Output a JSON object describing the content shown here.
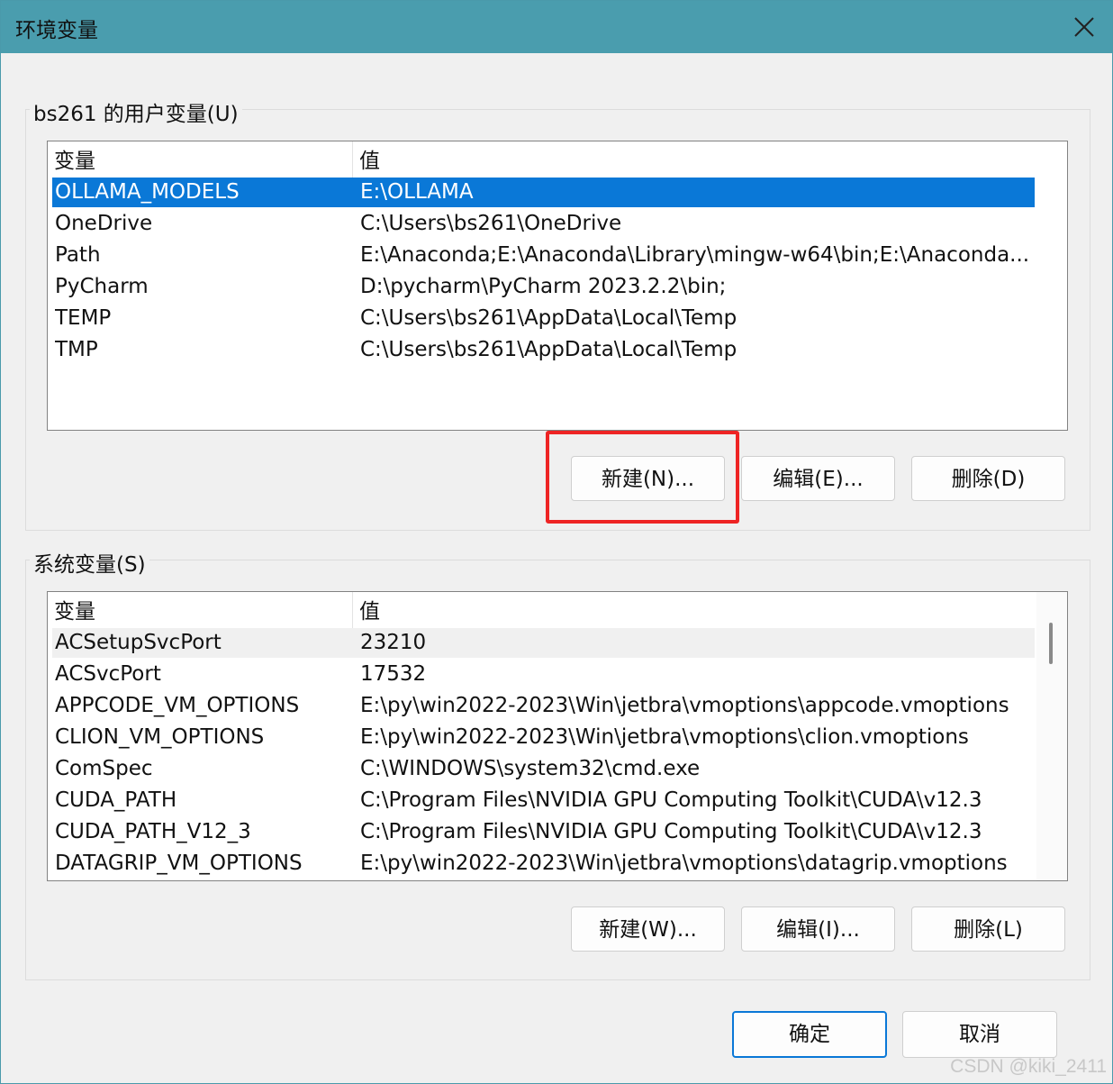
{
  "window": {
    "title": "环境变量",
    "close_icon": "close-icon"
  },
  "user_vars": {
    "group_label": "bs261 的用户变量(U)",
    "columns": [
      "变量",
      "值"
    ],
    "rows": [
      {
        "name": "OLLAMA_MODELS",
        "value": "E:\\OLLAMA"
      },
      {
        "name": "OneDrive",
        "value": "C:\\Users\\bs261\\OneDrive"
      },
      {
        "name": "Path",
        "value": "E:\\Anaconda;E:\\Anaconda\\Library\\mingw-w64\\bin;E:\\Anaconda..."
      },
      {
        "name": "PyCharm",
        "value": "D:\\pycharm\\PyCharm 2023.2.2\\bin;"
      },
      {
        "name": "TEMP",
        "value": "C:\\Users\\bs261\\AppData\\Local\\Temp"
      },
      {
        "name": "TMP",
        "value": "C:\\Users\\bs261\\AppData\\Local\\Temp"
      }
    ],
    "selected_row": 0,
    "buttons": {
      "new_label": "新建(N)...",
      "edit_label": "编辑(E)...",
      "delete_label": "删除(D)"
    }
  },
  "system_vars": {
    "group_label": "系统变量(S)",
    "columns": [
      "变量",
      "值"
    ],
    "rows": [
      {
        "name": "ACSetupSvcPort",
        "value": "23210"
      },
      {
        "name": "ACSvcPort",
        "value": "17532"
      },
      {
        "name": "APPCODE_VM_OPTIONS",
        "value": "E:\\py\\win2022-2023\\Win\\jetbra\\vmoptions\\appcode.vmoptions"
      },
      {
        "name": "CLION_VM_OPTIONS",
        "value": "E:\\py\\win2022-2023\\Win\\jetbra\\vmoptions\\clion.vmoptions"
      },
      {
        "name": "ComSpec",
        "value": "C:\\WINDOWS\\system32\\cmd.exe"
      },
      {
        "name": "CUDA_PATH",
        "value": "C:\\Program Files\\NVIDIA GPU Computing Toolkit\\CUDA\\v12.3"
      },
      {
        "name": "CUDA_PATH_V12_3",
        "value": "C:\\Program Files\\NVIDIA GPU Computing Toolkit\\CUDA\\v12.3"
      },
      {
        "name": "DATAGRIP_VM_OPTIONS",
        "value": "E:\\py\\win2022-2023\\Win\\jetbra\\vmoptions\\datagrip.vmoptions"
      }
    ],
    "hover_row": 0,
    "buttons": {
      "new_label": "新建(W)...",
      "edit_label": "编辑(I)...",
      "delete_label": "删除(L)"
    }
  },
  "dialog_buttons": {
    "ok_label": "确定",
    "cancel_label": "取消"
  },
  "watermark": "CSDN @kiki_2411",
  "colors": {
    "titlebar": "#4a9dae",
    "selection": "#0a78d7",
    "highlight_box": "#ee2424"
  }
}
